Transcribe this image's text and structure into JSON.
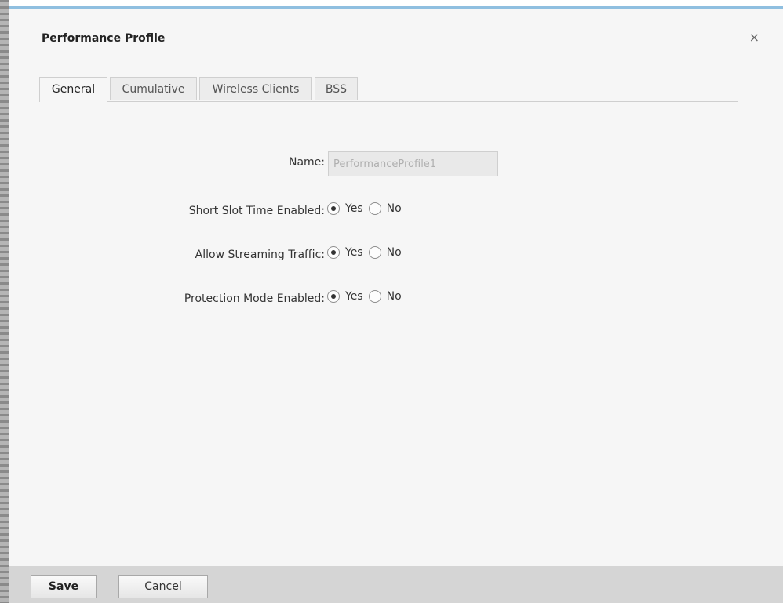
{
  "dialog": {
    "title": "Performance Profile",
    "close_symbol": "×"
  },
  "tabs": [
    {
      "label": "General",
      "active": true
    },
    {
      "label": "Cumulative",
      "active": false
    },
    {
      "label": "Wireless Clients",
      "active": false
    },
    {
      "label": "BSS",
      "active": false
    }
  ],
  "form": {
    "name": {
      "label": "Name:",
      "value": "PerformanceProfile1"
    },
    "short_slot_time": {
      "label": "Short Slot Time Enabled:",
      "yes_label": "Yes",
      "no_label": "No",
      "selected": "Yes"
    },
    "allow_streaming": {
      "label": "Allow Streaming Traffic:",
      "yes_label": "Yes",
      "no_label": "No",
      "selected": "Yes"
    },
    "protection_mode": {
      "label": "Protection Mode Enabled:",
      "yes_label": "Yes",
      "no_label": "No",
      "selected": "Yes"
    }
  },
  "footer": {
    "save_label": "Save",
    "cancel_label": "Cancel"
  },
  "colors": {
    "dialog_background": "#f6f6f6",
    "title_bar_accent": "#8fbfe0",
    "footer_background": "#d5d5d5"
  }
}
